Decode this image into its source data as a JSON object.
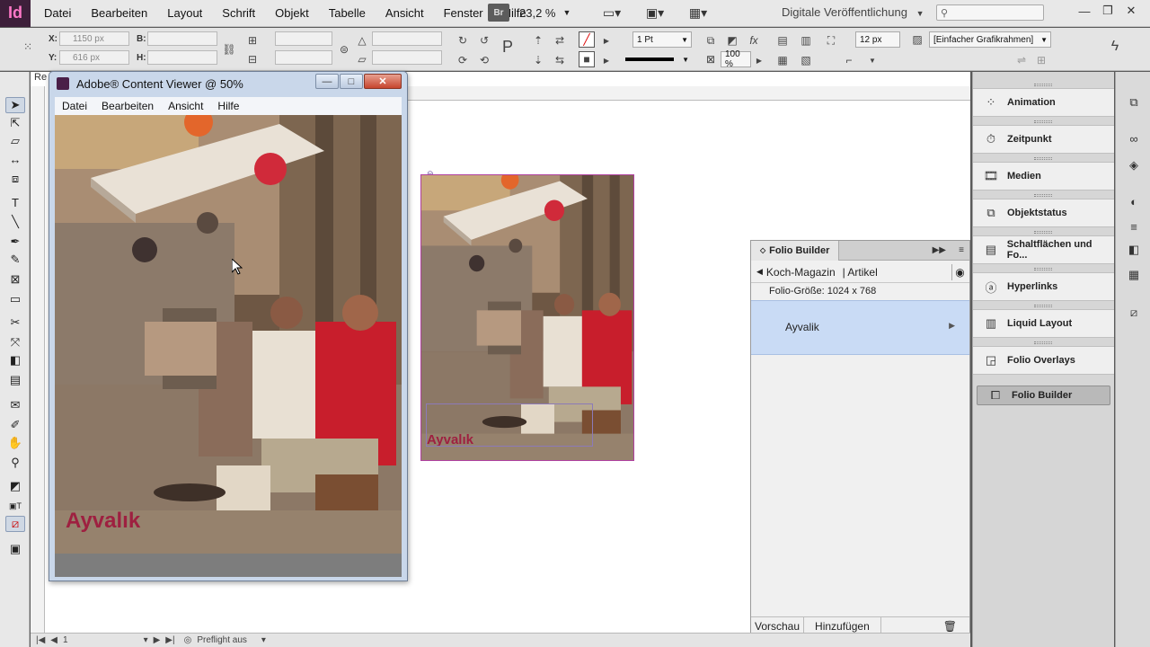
{
  "app": {
    "logo": "Id",
    "menu": [
      "Datei",
      "Bearbeiten",
      "Layout",
      "Schrift",
      "Objekt",
      "Tabelle",
      "Ansicht",
      "Fenster",
      "Hilfe"
    ],
    "bridge_label": "Br",
    "zoom": "23,2 %",
    "workspace": "Digitale Veröffentlichung",
    "search_placeholder": ""
  },
  "control_panel": {
    "x_label": "X:",
    "x_value": "1150 px",
    "y_label": "Y:",
    "y_value": "616 px",
    "b_label": "B:",
    "h_label": "H:",
    "stroke_weight": "1 Pt",
    "scale": "100 %",
    "offset": "12 px",
    "frame_style": "[Einfacher Grafikrahmen]"
  },
  "document": {
    "tab_label": "Re"
  },
  "content_viewer": {
    "title": "Adobe® Content Viewer @ 50%",
    "menu": [
      "Datei",
      "Bearbeiten",
      "Ansicht",
      "Hilfe"
    ],
    "photo_caption": "Ayvalık"
  },
  "page_frame": {
    "caption": "Ayvalık"
  },
  "folio_builder": {
    "tab_title": "Folio Builder",
    "breadcrumb_folio": "Koch-Magazin",
    "breadcrumb_section": "| Artikel",
    "folio_size": "Folio-Größe: 1024 x 768",
    "article": "Ayvalik",
    "footer_preview": "Vorschau",
    "footer_add": "Hinzufügen"
  },
  "dock": {
    "items": [
      {
        "label": "Animation",
        "icon": "animation-icon"
      },
      {
        "label": "Zeitpunkt",
        "icon": "timing-icon"
      },
      {
        "label": "Medien",
        "icon": "media-icon"
      },
      {
        "label": "Objektstatus",
        "icon": "object-states-icon"
      },
      {
        "label": "Schaltflächen und Fo...",
        "icon": "buttons-forms-icon"
      },
      {
        "label": "Hyperlinks",
        "icon": "hyperlinks-icon"
      },
      {
        "label": "Liquid Layout",
        "icon": "liquid-layout-icon"
      },
      {
        "label": "Folio Overlays",
        "icon": "folio-overlays-icon"
      },
      {
        "label": "Folio Builder",
        "icon": "folio-builder-icon"
      }
    ]
  },
  "statusbar": {
    "page": "1",
    "preflight": "Preflight aus"
  },
  "colors": {
    "accent_magenta": "#b040a0",
    "selection_blue": "#c9dbf5",
    "title_red": "#9e2040"
  }
}
